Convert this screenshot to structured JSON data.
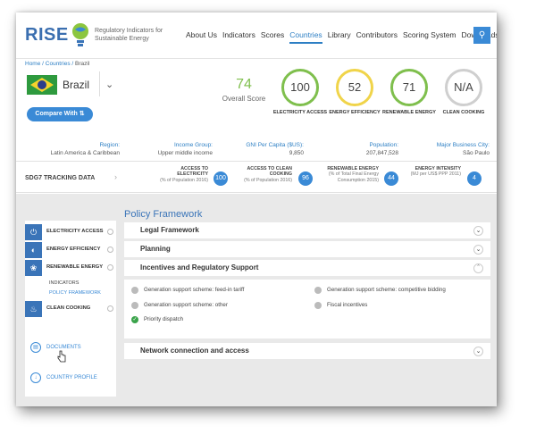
{
  "header": {
    "logo": "RISE",
    "logo_subtitle": "Regulatory Indicators for Sustainable Energy",
    "nav": [
      "About Us",
      "Indicators",
      "Scores",
      "Countries",
      "Library",
      "Contributors",
      "Scoring System",
      "Downloads"
    ],
    "active_nav": "Countries",
    "search_icon": "search-icon"
  },
  "breadcrumb": {
    "home": "Home",
    "countries": "Countries",
    "current": "Brazil"
  },
  "country": {
    "name": "Brazil",
    "compare_label": "Compare With"
  },
  "overall": {
    "value": "74",
    "label": "Overall Score"
  },
  "pillars": [
    {
      "value": "100",
      "label": "ELECTRICITY ACCESS",
      "color": "#7fbf4d"
    },
    {
      "value": "52",
      "label": "ENERGY EFFICIENCY",
      "color": "#f0d44a"
    },
    {
      "value": "71",
      "label": "RENEWABLE ENERGY",
      "color": "#7fbf4d"
    },
    {
      "value": "N/A",
      "label": "CLEAN COOKING",
      "color": "#cfcfcf"
    }
  ],
  "info": [
    {
      "key": "Region:",
      "value": "Latin America & Caribbean"
    },
    {
      "key": "Income Group:",
      "value": "Upper middle income"
    },
    {
      "key": "GNI Per Capita ($US):",
      "value": "9,850"
    },
    {
      "key": "Population:",
      "value": "207,847,528"
    },
    {
      "key": "Major Business City:",
      "value": "São Paulo"
    }
  ],
  "sdg": {
    "label": "SDG7 TRACKING DATA",
    "items": [
      {
        "title": "ACCESS TO ELECTRICITY",
        "sub": "(% of Population 2016)",
        "value": "100"
      },
      {
        "title": "ACCESS TO CLEAN COOKING",
        "sub": "(% of Population 2016)",
        "value": "96"
      },
      {
        "title": "RENEWABLE ENERGY",
        "sub": "(% of Total Final Energy Consumption 2015)",
        "value": "44"
      },
      {
        "title": "ENERGY INTENSITY",
        "sub": "(MJ per US$ PPP 2011)",
        "value": "4"
      }
    ]
  },
  "sidebar": {
    "items": [
      {
        "label": "ELECTRICITY ACCESS",
        "icon": "power-icon"
      },
      {
        "label": "ENERGY EFFICIENCY",
        "icon": "efficiency-icon"
      },
      {
        "label": "RENEWABLE ENERGY",
        "icon": "wind-turbine-icon"
      },
      {
        "label": "CLEAN COOKING",
        "icon": "cooking-pot-icon"
      }
    ],
    "sub": [
      "INDICATORS",
      "POLICY FRAMEWORK"
    ],
    "documents": "DOCUMENTS",
    "profile": "COUNTRY PROFILE"
  },
  "policy": {
    "title": "Policy Framework",
    "sections": [
      "Legal Framework",
      "Planning",
      "Incentives and Regulatory Support",
      "Network connection and access"
    ],
    "items": [
      {
        "label": "Generation support scheme: feed-in tariff",
        "status": "grey"
      },
      {
        "label": "Generation support scheme: competitive bidding",
        "status": "grey"
      },
      {
        "label": "Generation support scheme: other",
        "status": "grey"
      },
      {
        "label": "Fiscal incentives",
        "status": "grey"
      },
      {
        "label": "Priority dispatch",
        "status": "green"
      }
    ]
  }
}
